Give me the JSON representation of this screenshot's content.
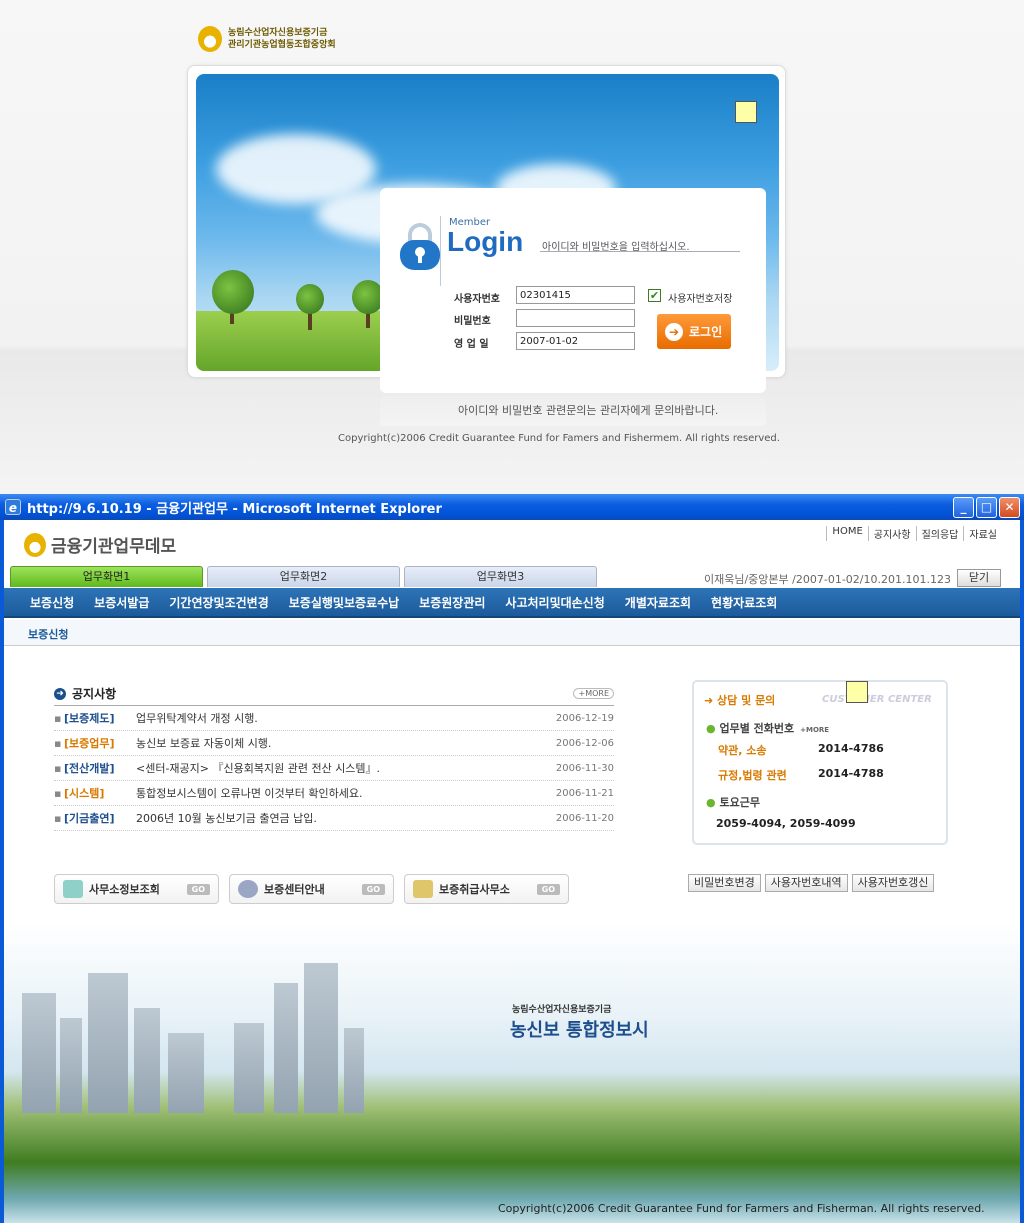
{
  "login": {
    "org_line1": "농림수산업자신용보증기금",
    "org_line2": "관리기관농업협동조합중앙회",
    "member": "Member",
    "title": "Login",
    "hint": "아이디와 비밀번호을 입력하십시오.",
    "user_label": "사용자번호",
    "user_value": "02301415",
    "pw_label": "비밀번호",
    "pw_value": "",
    "date_label": "영 업 일",
    "date_value": "2007-01-02",
    "save_label": "사용자번호저장",
    "save_checked": "✔",
    "button": "로그인",
    "note": "아이디와 비밀번호 관련문의는 관리자에게 문의바랍니다.",
    "copyright": "Copyright(c)2006 Credit Guarantee Fund for Famers and Fishermem. All rights reserved."
  },
  "window": {
    "title": "http://9.6.10.19 - 금융기관업무 - Microsoft Internet Explorer",
    "min": "_",
    "max": "□",
    "close": "✕",
    "ie_glyph": "e"
  },
  "site": {
    "logo": "금융기관업무데모",
    "util": [
      "HOME",
      "공지사항",
      "질의응답",
      "자료실"
    ],
    "tabs": [
      "업무화면1",
      "업무화면2",
      "업무화면3"
    ],
    "user_info": "이재욱님/중앙본부 /2007-01-02/10.201.101.123",
    "close_btn": "닫기",
    "menu": [
      "보증신청",
      "보증서발급",
      "기간연장및조건변경",
      "보증실행및보증료수납",
      "보증원장관리",
      "사고처리및대손신청",
      "개별자료조회",
      "현황자료조회"
    ],
    "submenu": "보증신청"
  },
  "notice": {
    "title": "공지사항",
    "more": "+MORE",
    "rows": [
      {
        "cat": "[보증제도]",
        "text": "업무위탁계약서 개정 시행.",
        "date": "2006-12-19",
        "color": "#1d4f8e"
      },
      {
        "cat": "[보증업무]",
        "text": "농신보 보증료 자동이체 시행.",
        "date": "2006-12-06",
        "color": "#d87a00"
      },
      {
        "cat": "[전산개발]",
        "text": "<센터-재공지> 『신용회복지원 관련 전산 시스템』.",
        "date": "2006-11-30",
        "color": "#1d4f8e"
      },
      {
        "cat": "[시스템]",
        "text": "통합정보시스템이 오류나면 이것부터 확인하세요.",
        "date": "2006-11-21",
        "color": "#d87a00"
      },
      {
        "cat": "[기금출연]",
        "text": "2006년 10월 농신보기금 출연금 납입.",
        "date": "2006-11-20",
        "color": "#1d4f8e"
      }
    ]
  },
  "quick_links": [
    {
      "label": "사무소정보조회",
      "go": "GO"
    },
    {
      "label": "보증센터안내",
      "go": "GO"
    },
    {
      "label": "보증취급사무소",
      "go": "GO"
    }
  ],
  "consult": {
    "title": "상담 및 문의",
    "en": "CUSTOMER CENTER",
    "phone_title": "업무별 전화번호",
    "more": "+MORE",
    "k1": "약관, 소송",
    "v1": "2014-4786",
    "k2": "규정,법령 관련",
    "v2": "2014-4788",
    "sat_title": "토요근무",
    "sat_val": "2059-4094, 2059-4099",
    "buttons": [
      "비밀번호변경",
      "사용자번호내역",
      "사용자번호갱신"
    ]
  },
  "scene": {
    "sub": "농림수산업자신용보증기금",
    "title": "농신보 통합정보시",
    "copyright": "Copyright(c)2006 Credit Guarantee Fund for Farmers and Fisherman. All rights reserved."
  }
}
